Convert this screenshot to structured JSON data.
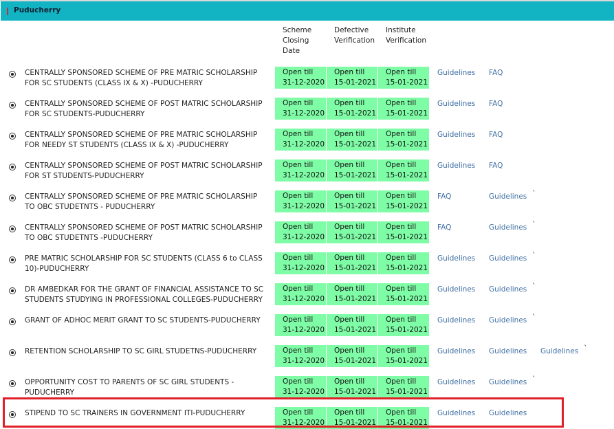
{
  "header": {
    "title": "Puducherry"
  },
  "columns": {
    "scheme_closing": "Scheme\nClosing\nDate",
    "defective": "Defective\nVerification",
    "institute": "Institute\nVerification"
  },
  "rows": [
    {
      "name": "CENTRALLY SPONSORED SCHEME OF PRE MATRIC SCHOLARSHIP FOR SC STUDENTS (CLASS IX & X) -PUDUCHERRY",
      "closing": "Open till\n31-12-2020",
      "defective": "Open till\n15-01-2021",
      "institute": "Open till\n15-01-2021",
      "links": [
        "Guidelines",
        "FAQ"
      ],
      "tick": ""
    },
    {
      "name": "CENTRALLY SPONSORED SCHEME OF POST MATRIC SCHOLARSHIP FOR SC STUDENTS-PUDUCHERRY",
      "closing": "Open till\n31-12-2020",
      "defective": "Open till\n15-01-2021",
      "institute": "Open till\n15-01-2021",
      "links": [
        "Guidelines",
        "FAQ"
      ],
      "tick": ""
    },
    {
      "name": "CENTRALLY SPONSORED SCHEME OF PRE MATRIC SCHOLARSHIP FOR NEEDY ST STUDENTS (CLASS IX & X) -PUDUCHERRY",
      "closing": "Open till\n31-12-2020",
      "defective": "Open till\n15-01-2021",
      "institute": "Open till\n15-01-2021",
      "links": [
        "Guidelines",
        "FAQ"
      ],
      "tick": ""
    },
    {
      "name": "CENTRALLY SPONSORED SCHEME OF POST MATRIC SCHOLARSHIP FOR ST STUDENTS-PUDUCHERRY",
      "closing": "Open till\n31-12-2020",
      "defective": "Open till\n15-01-2021",
      "institute": "Open till\n15-01-2021",
      "links": [
        "Guidelines",
        "FAQ"
      ],
      "tick": ""
    },
    {
      "name": "CENTRALLY SPONSORED SCHEME OF PRE MATRIC SCHOLARSHIP TO OBC STUDETNTS - PUDUCHERRY",
      "closing": "Open till\n31-12-2020",
      "defective": "Open till\n15-01-2021",
      "institute": "Open till\n15-01-2021",
      "links": [
        "FAQ",
        "Guidelines"
      ],
      "tick": "`"
    },
    {
      "name": "CENTRALLY SPONSORED SCHEME OF POST MATRIC SCHOLARSHIP TO OBC STUDETNTS -PUDUCHERRY",
      "closing": "Open till\n31-12-2020",
      "defective": "Open till\n15-01-2021",
      "institute": "Open till\n15-01-2021",
      "links": [
        "FAQ",
        "Guidelines"
      ],
      "tick": "`"
    },
    {
      "name": "PRE MATRIC SCHOLARSHIP FOR SC STUDENTS (CLASS 6 to CLASS 10)-PUDUCHERRY",
      "closing": "Open till\n31-12-2020",
      "defective": "Open till\n15-01-2021",
      "institute": "Open till\n15-01-2021",
      "links": [
        "Guidelines",
        "Guidelines"
      ],
      "tick": "`"
    },
    {
      "name": "DR AMBEDKAR FOR THE GRANT OF FINANCIAL ASSISTANCE TO SC STUDENTS STUDYING IN PROFESSIONAL COLLEGES-PUDUCHERRY",
      "closing": "Open till\n31-12-2020",
      "defective": "Open till\n15-01-2021",
      "institute": "Open till\n15-01-2021",
      "links": [
        "Guidelines",
        "Guidelines"
      ],
      "tick": "`"
    },
    {
      "name": "GRANT OF ADHOC MERIT GRANT TO SC STUDENTS-PUDUCHERRY",
      "closing": "Open till\n31-12-2020",
      "defective": "Open till\n15-01-2021",
      "institute": "Open till\n15-01-2021",
      "links": [
        "Guidelines",
        "Guidelines"
      ],
      "tick": "`"
    },
    {
      "name": "RETENTION SCHOLARSHIP TO SC GIRL STUDETNS-PUDUCHERRY",
      "closing": "Open till\n31-12-2020",
      "defective": "Open till\n15-01-2021",
      "institute": "Open till\n15-01-2021",
      "links": [
        "Guidelines",
        "Guidelines",
        "Guidelines"
      ],
      "tick": "`"
    },
    {
      "name": "OPPORTUNITY COST TO PARENTS OF SC GIRL STUDENTS -PUDUCHERRY",
      "closing": "Open till\n31-12-2020",
      "defective": "Open till\n15-01-2021",
      "institute": "Open till\n15-01-2021",
      "links": [
        "Guidelines",
        "Guidelines"
      ],
      "tick": "`"
    },
    {
      "name": "STIPEND TO SC TRAINERS IN GOVERNMENT ITI-PUDUCHERRY",
      "closing": "Open till\n31-12-2020",
      "defective": "Open till\n15-01-2021",
      "institute": "Open till\n15-01-2021",
      "links": [
        "Guidelines",
        "Guidelines"
      ],
      "tick": ""
    }
  ],
  "colors": {
    "header_bg": "#12b3c3",
    "date_bg": "#7ffca6",
    "link": "#3f6fa3",
    "highlight": "#e01f27"
  }
}
